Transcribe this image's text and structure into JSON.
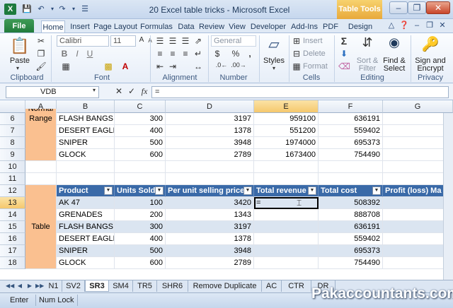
{
  "window": {
    "title": "20 Excel table tricks - Microsoft Excel",
    "app_icon": "X",
    "context_tab": "Table Tools"
  },
  "tabs": [
    "File",
    "Home",
    "Insert",
    "Page Layout",
    "Formulas",
    "Data",
    "Review",
    "View",
    "Developer",
    "Add-Ins",
    "PDF",
    "Design"
  ],
  "ribbon": {
    "paste": "Paste",
    "font_name": "Calibri",
    "font_size": "11",
    "bold": "B",
    "italic": "I",
    "underline": "U",
    "number_format": "General",
    "currency": "$",
    "percent": "%",
    "comma": ",",
    "styles": "Styles",
    "insert": "Insert",
    "delete": "Delete",
    "format": "Format",
    "sum": "Σ",
    "sort_filter": "Sort &",
    "sort_filter2": "Filter",
    "find_select": "Find &",
    "find_select2": "Select",
    "sign": "Sign and",
    "sign2": "Encrypt",
    "groups": {
      "clipboard": "Clipboard",
      "font": "Font",
      "alignment": "Alignment",
      "number": "Number",
      "cells": "Cells",
      "editing": "Editing",
      "privacy": "Privacy"
    }
  },
  "formula_bar": {
    "name_box": "VDB",
    "formula": "=",
    "fx": "fx"
  },
  "columns": [
    "A",
    "B",
    "C",
    "D",
    "E",
    "F",
    "G"
  ],
  "rows": [
    {
      "n": "6",
      "cells": [
        "",
        "FLASH BANGS",
        "300",
        "3197",
        "959100",
        "636191",
        ""
      ]
    },
    {
      "n": "7",
      "cells": [
        "",
        "DESERT EAGLE",
        "400",
        "1378",
        "551200",
        "559402",
        ""
      ]
    },
    {
      "n": "8",
      "cells": [
        "",
        "SNIPER",
        "500",
        "3948",
        "1974000",
        "695373",
        ""
      ]
    },
    {
      "n": "9",
      "cells": [
        "",
        "GLOCK",
        "600",
        "2789",
        "1673400",
        "754490",
        ""
      ]
    },
    {
      "n": "10",
      "cells": [
        "",
        "",
        "",
        "",
        "",
        "",
        ""
      ]
    },
    {
      "n": "11",
      "cells": [
        "",
        "",
        "",
        "",
        "",
        "",
        ""
      ]
    },
    {
      "n": "12",
      "cells": [
        "",
        "Product",
        "Units Sold",
        "Per unit selling price",
        "Total revenue",
        "Total cost",
        "Profit (loss) Ma"
      ]
    },
    {
      "n": "13",
      "cells": [
        "",
        "AK 47",
        "100",
        "3420",
        "=",
        "508392",
        ""
      ]
    },
    {
      "n": "14",
      "cells": [
        "",
        "GRENADES",
        "200",
        "1343",
        "",
        "888708",
        ""
      ]
    },
    {
      "n": "15",
      "cells": [
        "",
        "FLASH BANGS",
        "300",
        "3197",
        "",
        "636191",
        ""
      ]
    },
    {
      "n": "16",
      "cells": [
        "",
        "DESERT EAGLE",
        "400",
        "1378",
        "",
        "559402",
        ""
      ]
    },
    {
      "n": "17",
      "cells": [
        "",
        "SNIPER",
        "500",
        "3948",
        "",
        "695373",
        ""
      ]
    },
    {
      "n": "18",
      "cells": [
        "",
        "GLOCK",
        "600",
        "2789",
        "",
        "754490",
        ""
      ]
    }
  ],
  "merged_labels": {
    "normal_range_top": "Normal",
    "normal_range": "Range",
    "table": "Table"
  },
  "sheet_tabs": [
    "N1",
    "SV2",
    "SR3",
    "SM4",
    "TR5",
    "SHR6",
    "Remove Duplicate",
    "AC",
    "CTR",
    "DR"
  ],
  "active_sheet": "SR3",
  "status": {
    "mode": "Enter",
    "num_lock": "Num Lock"
  },
  "watermark": "Pakaccountants.com",
  "colors": {
    "header_blue": "#3a6aa8",
    "band_blue": "#dbe5f1",
    "orange": "#fac090",
    "file_green": "#207a3a"
  }
}
